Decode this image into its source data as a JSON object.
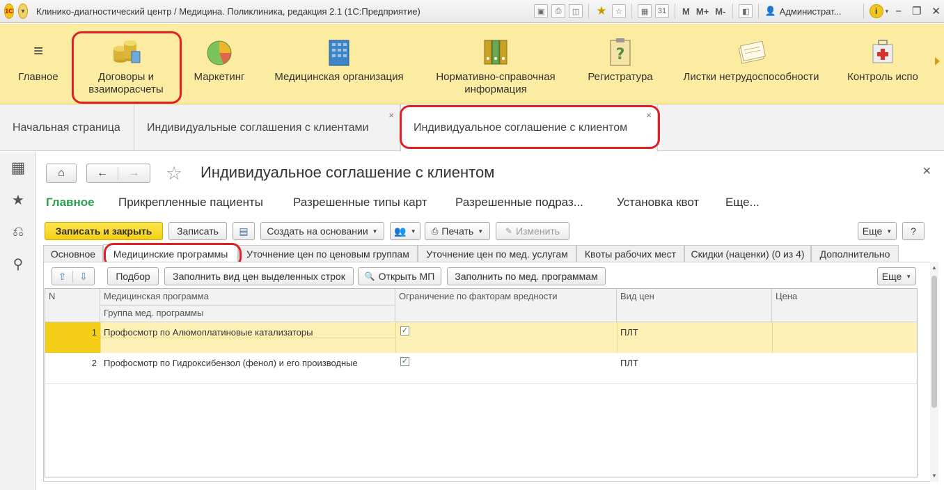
{
  "window": {
    "title": "Клинико-диагностический центр / Медицина. Поликлиника, редакция 2.1  (1С:Предприятие)",
    "user": "Администрат...",
    "m_labels": [
      "M",
      "M+",
      "M-"
    ]
  },
  "sections": [
    {
      "label": "Главное"
    },
    {
      "label": "Договоры и\nвзаиморасчеты"
    },
    {
      "label": "Маркетинг"
    },
    {
      "label": "Медицинская организация"
    },
    {
      "label": "Нормативно-справочная\nинформация"
    },
    {
      "label": "Регистратура"
    },
    {
      "label": "Листки нетрудоспособности"
    },
    {
      "label": "Контроль испо"
    }
  ],
  "open_tabs": [
    {
      "label": "Начальная страница"
    },
    {
      "label": "Индивидуальные соглашения с клиентами"
    },
    {
      "label": "Индивидуальное соглашение с клиентом"
    }
  ],
  "form": {
    "title": "Индивидуальное соглашение с клиентом",
    "nav": [
      "Главное",
      "Прикрепленные пациенты",
      "Разрешенные типы карт",
      "Разрешенные подраз...",
      "Установка квот",
      "Еще..."
    ],
    "buttons": {
      "save_close": "Записать и закрыть",
      "save": "Записать",
      "create_based": "Создать на основании",
      "print": "Печать",
      "edit": "Изменить",
      "more": "Еще",
      "help": "?"
    },
    "page_tabs": [
      "Основное",
      "Медицинские программы",
      "Уточнение цен по ценовым группам",
      "Уточнение цен по мед. услугам",
      "Квоты рабочих мест",
      "Скидки (наценки) (0 из 4)",
      "Дополнительно"
    ],
    "table_toolbar": {
      "select": "Подбор",
      "fill_price": "Заполнить вид цен выделенных строк",
      "open_mp": "Открыть МП",
      "fill_by_mp": "Заполнить по мед. программам",
      "more": "Еще"
    },
    "table": {
      "headers": {
        "n": "N",
        "program": "Медицинская программа",
        "group": "Группа мед. программы",
        "restriction": "Ограничение по факторам вредности",
        "price_type": "Вид цен",
        "price": "Цена"
      },
      "rows": [
        {
          "n": "1",
          "program": "Профосмотр по Алюмоплатиновые катализаторы",
          "group": "",
          "restriction": "✓",
          "price_type": "ПЛТ",
          "price": ""
        },
        {
          "n": "2",
          "program": "Профосмотр по Гидроксибензол (фенол) и его производные",
          "group": "",
          "restriction": "✓",
          "price_type": "ПЛТ",
          "price": ""
        }
      ]
    }
  },
  "colors": {
    "section_bg": "#fbeca2",
    "accent_green": "#27a14c",
    "primary_button": "#f5cf17",
    "highlight_red": "#e01f26",
    "selected_row": "#fdf1b6"
  }
}
